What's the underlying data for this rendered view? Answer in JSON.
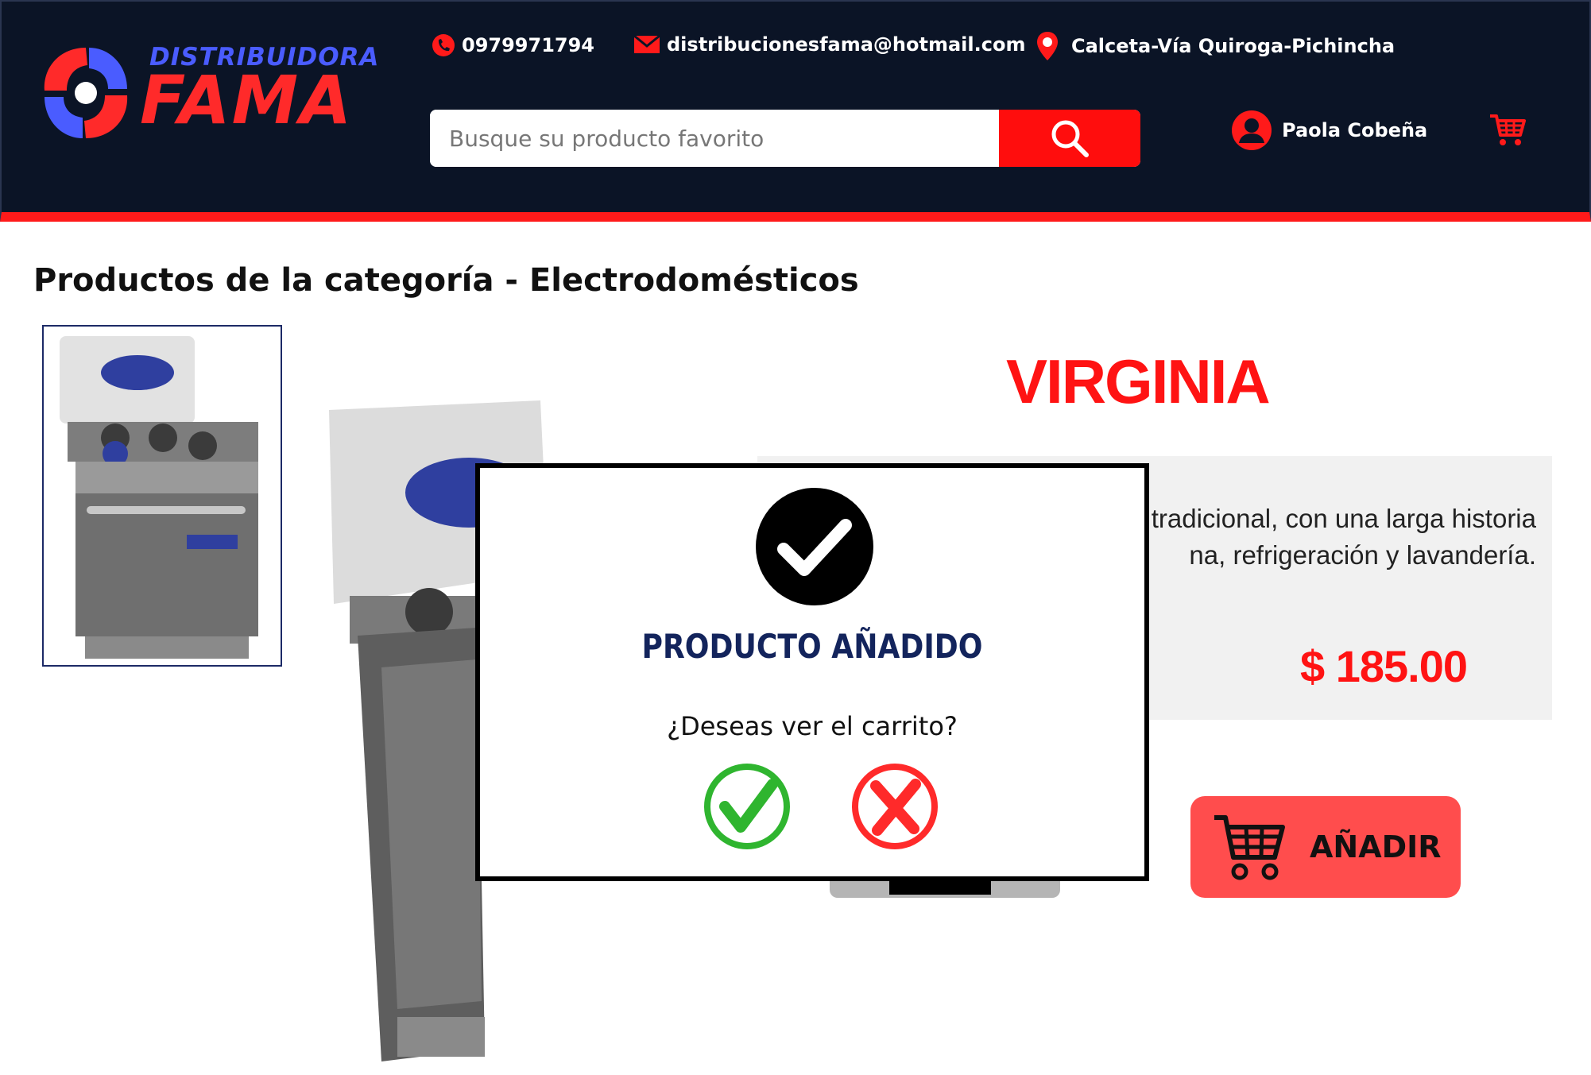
{
  "brand": {
    "top_text": "DISTRIBUIDORA",
    "main_text": "FAMA",
    "colors": {
      "navy": "#0b1426",
      "red": "#ff1a1a",
      "blue": "#4a5cff"
    }
  },
  "header": {
    "phone": "0979971794",
    "email": "distribucionesfama@hotmail.com",
    "location": "Calceta-Vía Quiroga-Pichincha",
    "search": {
      "placeholder": "Busque su producto favorito",
      "value": ""
    },
    "user_name": "Paola Cobeña",
    "icons": [
      "phone-icon",
      "mail-icon",
      "location-pin-icon",
      "search-icon",
      "user-icon",
      "cart-icon"
    ]
  },
  "main": {
    "page_title": "Productos de la categoría - Electrodomésticos",
    "product": {
      "name": "VIRGINIA",
      "description_line1": "a y tradicional, con una larga historia",
      "description_line2": "na, refrigeración y lavandería.",
      "price": "$ 185.00",
      "add_button_label": "AÑADIR"
    }
  },
  "modal": {
    "title": "PRODUCTO AÑADIDO",
    "question": "¿Deseas ver el carrito?",
    "icons": [
      "success-check-icon",
      "confirm-yes-icon",
      "cancel-no-icon"
    ]
  }
}
